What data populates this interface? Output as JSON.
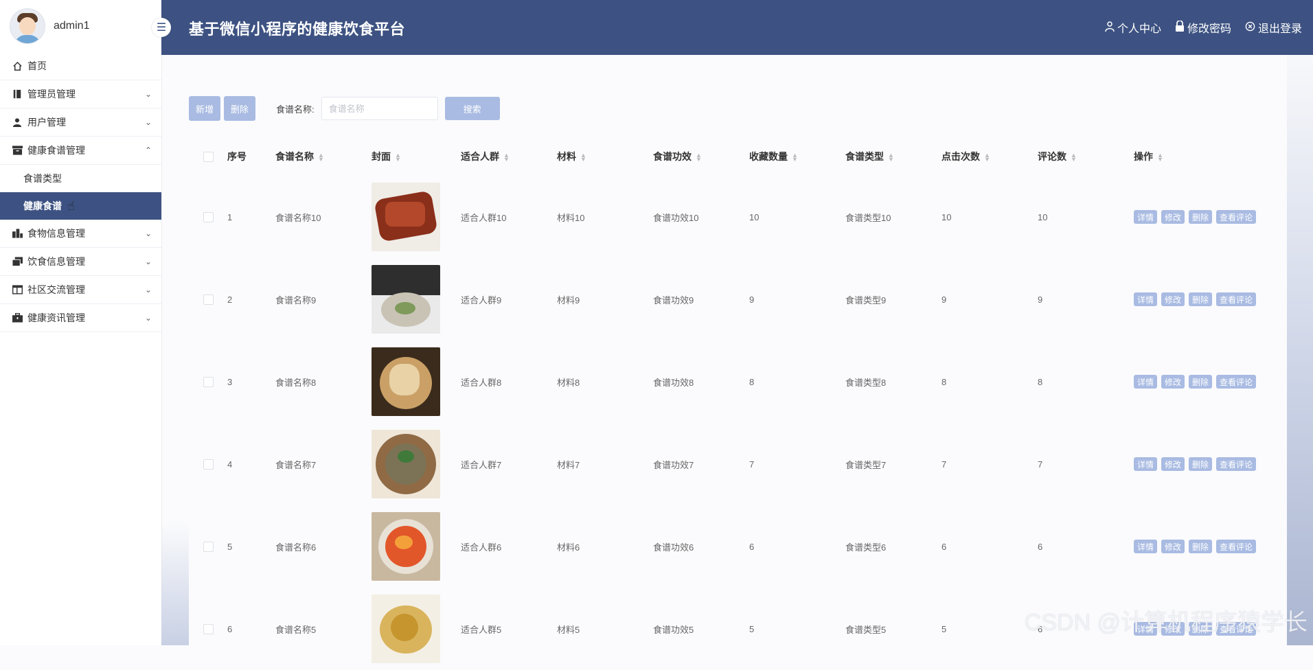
{
  "user": {
    "name": "admin1"
  },
  "sidebar": {
    "items": [
      {
        "label": "首页",
        "icon": "home-icon"
      },
      {
        "label": "管理员管理",
        "icon": "book-icon"
      },
      {
        "label": "用户管理",
        "icon": "user-icon"
      },
      {
        "label": "健康食谱管理",
        "icon": "box-icon",
        "expanded": true,
        "children": [
          {
            "label": "食谱类型"
          },
          {
            "label": "健康食谱",
            "active": true
          }
        ]
      },
      {
        "label": "食物信息管理",
        "icon": "building-icon"
      },
      {
        "label": "饮食信息管理",
        "icon": "copy-icon"
      },
      {
        "label": "社区交流管理",
        "icon": "table-icon"
      },
      {
        "label": "健康资讯管理",
        "icon": "briefcase-icon"
      }
    ]
  },
  "header": {
    "title": "基于微信小程序的健康饮食平台",
    "actions": [
      {
        "label": "个人中心",
        "icon": "person-icon"
      },
      {
        "label": "修改密码",
        "icon": "lock-icon"
      },
      {
        "label": "退出登录",
        "icon": "close-circle-icon"
      }
    ],
    "color": "#3d5282"
  },
  "toolbar": {
    "add_label": "新增",
    "delete_label": "删除",
    "search_label": "食谱名称:",
    "search_placeholder": "食谱名称",
    "search_button": "搜索",
    "button_color": "#a9bbe2"
  },
  "table": {
    "headers": [
      "序号",
      "食谱名称",
      "封面",
      "适合人群",
      "材料",
      "食谱功效",
      "收藏数量",
      "食谱类型",
      "点击次数",
      "评论数",
      "操作"
    ],
    "row_actions": [
      "详情",
      "修改",
      "删除",
      "查看评论"
    ],
    "rows": [
      {
        "index": "1",
        "name": "食谱名称10",
        "crowd": "适合人群10",
        "material": "材料10",
        "effect": "食谱功效10",
        "favorites": "10",
        "type": "食谱类型10",
        "clicks": "10",
        "comments": "10"
      },
      {
        "index": "2",
        "name": "食谱名称9",
        "crowd": "适合人群9",
        "material": "材料9",
        "effect": "食谱功效9",
        "favorites": "9",
        "type": "食谱类型9",
        "clicks": "9",
        "comments": "9"
      },
      {
        "index": "3",
        "name": "食谱名称8",
        "crowd": "适合人群8",
        "material": "材料8",
        "effect": "食谱功效8",
        "favorites": "8",
        "type": "食谱类型8",
        "clicks": "8",
        "comments": "8"
      },
      {
        "index": "4",
        "name": "食谱名称7",
        "crowd": "适合人群7",
        "material": "材料7",
        "effect": "食谱功效7",
        "favorites": "7",
        "type": "食谱类型7",
        "clicks": "7",
        "comments": "7"
      },
      {
        "index": "5",
        "name": "食谱名称6",
        "crowd": "适合人群6",
        "material": "材料6",
        "effect": "食谱功效6",
        "favorites": "6",
        "type": "食谱类型6",
        "clicks": "6",
        "comments": "6"
      },
      {
        "index": "6",
        "name": "食谱名称5",
        "crowd": "适合人群5",
        "material": "材料5",
        "effect": "食谱功效5",
        "favorites": "5",
        "type": "食谱类型5",
        "clicks": "5",
        "comments": "6"
      }
    ]
  },
  "watermark": "CSDN @计算机程序猿学长"
}
